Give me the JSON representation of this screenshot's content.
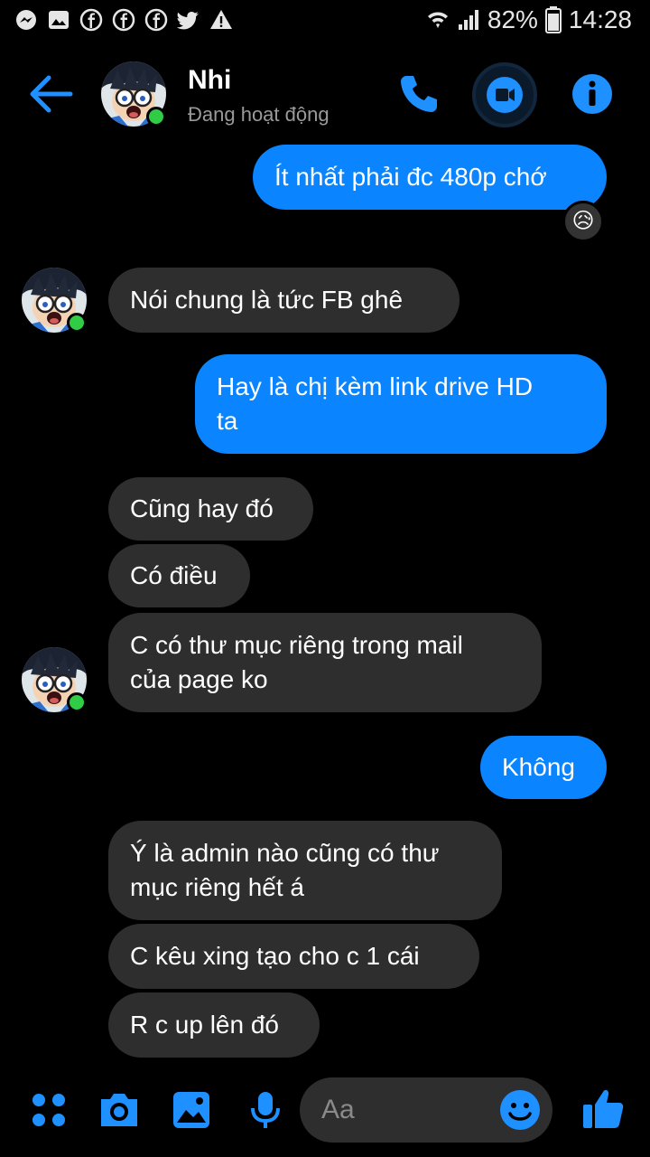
{
  "status_bar": {
    "battery": "82%",
    "time": "14:28",
    "notification_icons": [
      "messenger-icon",
      "gallery-icon",
      "facebook-icon",
      "facebook-icon",
      "facebook-icon",
      "twitter-icon",
      "warning-icon"
    ]
  },
  "header": {
    "name": "Nhi",
    "status": "Đang hoạt động"
  },
  "messages": [
    {
      "side": "out",
      "text": "Ít nhất phải đc 480p chớ",
      "reaction": "😥"
    },
    {
      "side": "in",
      "text": "Nói chung là tức FB ghê"
    },
    {
      "side": "out",
      "text": "Hay là chị kèm link drive HD\nta"
    },
    {
      "side": "in",
      "text": "Cũng hay đó"
    },
    {
      "side": "in",
      "text": "Có điều"
    },
    {
      "side": "in",
      "text": "C có thư mục riêng trong mail\ncủa page ko"
    },
    {
      "side": "out",
      "text": "Không"
    },
    {
      "side": "in",
      "text": "Ý là admin nào cũng có thư\nmục riêng hết á"
    },
    {
      "side": "in",
      "text": "C kêu xing tạo cho c 1 cái"
    },
    {
      "side": "in",
      "text": "R c up lên đó"
    }
  ],
  "composer": {
    "placeholder": "Aa"
  },
  "colors": {
    "accent": "#0a84ff",
    "incoming_bubble": "#2e2e2e",
    "online": "#31cc46",
    "background": "#000000"
  }
}
